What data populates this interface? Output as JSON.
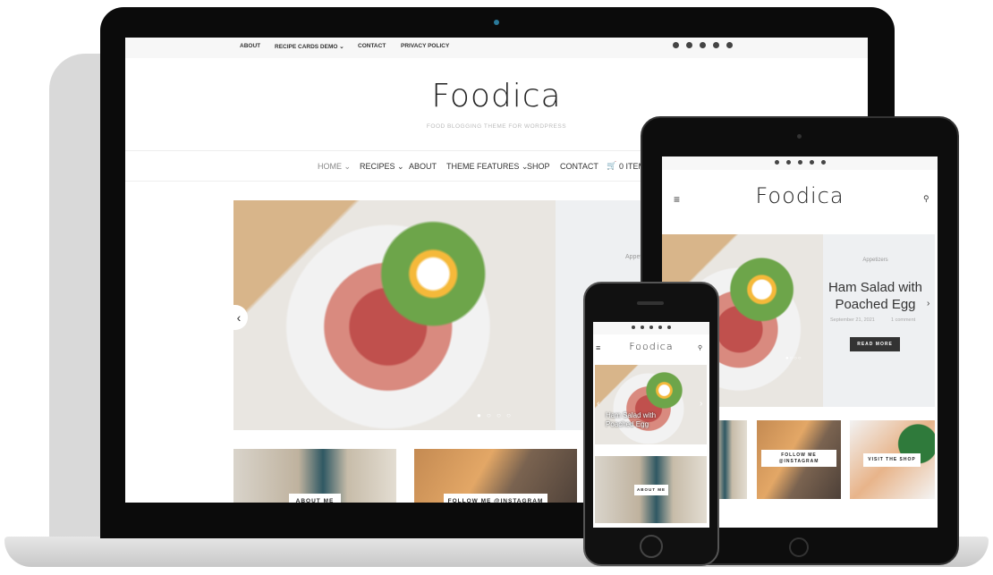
{
  "site": {
    "logo": "Foodica",
    "tagline": "FOOD BLOGGING THEME FOR WORDPRESS"
  },
  "topbar": {
    "links": [
      "ABOUT",
      "RECIPE CARDS DEMO ⌄",
      "CONTACT",
      "PRIVACY POLICY"
    ],
    "social": [
      "instagram-icon",
      "facebook-icon",
      "twitter-icon",
      "pinterest-icon",
      "email-icon"
    ]
  },
  "nav": {
    "items": [
      "HOME ⌄",
      "RECIPES ⌄",
      "ABOUT",
      "THEME FEATURES ⌄",
      "SHOP",
      "CONTACT"
    ],
    "cart": "0 ITEMS"
  },
  "hero": {
    "category": "Appetizers",
    "title": "Ham Salad with Poached Egg",
    "date": "September 21, 2021",
    "comments": "1 comment",
    "button": "READ MORE"
  },
  "cards": {
    "about": "ABOUT ME",
    "instagram": "FOLLOW ME @INSTAGRAM",
    "instagram_short": "FOLLOW ME\n@INSTAGRAM",
    "shop": "VISIT THE SHOP"
  },
  "colors": {
    "accent": "#333333",
    "topbar": "#f7f7f7"
  }
}
